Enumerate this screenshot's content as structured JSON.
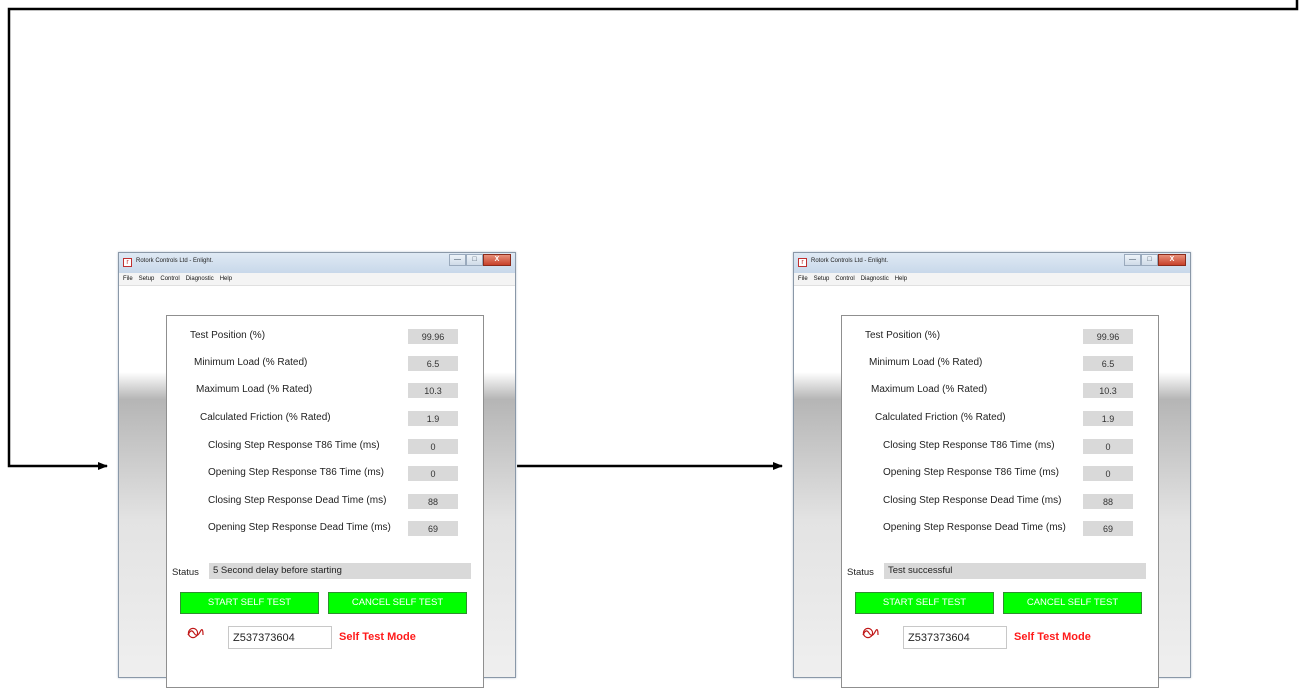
{
  "flow": {
    "line_color": "#000000",
    "arrow_style": "filled-triangle"
  },
  "windows": [
    {
      "title": "Rotork Controls Ltd - Enlight.",
      "controls": {
        "minimize": "—",
        "maximize": "□",
        "close": "X"
      },
      "menu": [
        "File",
        "Setup",
        "Control",
        "Diagnostic",
        "Help"
      ],
      "fields": [
        {
          "label": "Test Position (%)",
          "value": "99.96"
        },
        {
          "label": "Minimum Load (% Rated)",
          "value": "6.5"
        },
        {
          "label": "Maximum Load (% Rated)",
          "value": "10.3"
        },
        {
          "label": "Calculated Friction (% Rated)",
          "value": "1.9"
        },
        {
          "label": "Closing Step Response T86 Time (ms)",
          "value": "0"
        },
        {
          "label": "Opening Step Response T86 Time (ms)",
          "value": "0"
        },
        {
          "label": "Closing Step Response Dead Time (ms)",
          "value": "88"
        },
        {
          "label": "Opening Step Response Dead Time (ms)",
          "value": "69"
        }
      ],
      "status_label": "Status",
      "status_text": "5 Second delay before starting",
      "start_button": "START SELF TEST",
      "cancel_button": "CANCEL SELF TEST",
      "logo_icon": "rotork-wave-icon",
      "serial_number": "Z537373604",
      "mode_text": "Self Test Mode",
      "colors": {
        "button_bg": "#00ff00",
        "mode_text": "#ff1a1a",
        "field_bg": "#d9d9d9"
      }
    },
    {
      "title": "Rotork Controls Ltd - Enlight.",
      "controls": {
        "minimize": "—",
        "maximize": "□",
        "close": "X"
      },
      "menu": [
        "File",
        "Setup",
        "Control",
        "Diagnostic",
        "Help"
      ],
      "fields": [
        {
          "label": "Test Position (%)",
          "value": "99.96"
        },
        {
          "label": "Minimum Load (% Rated)",
          "value": "6.5"
        },
        {
          "label": "Maximum Load (% Rated)",
          "value": "10.3"
        },
        {
          "label": "Calculated Friction (% Rated)",
          "value": "1.9"
        },
        {
          "label": "Closing Step Response T86 Time (ms)",
          "value": "0"
        },
        {
          "label": "Opening Step Response T86 Time (ms)",
          "value": "0"
        },
        {
          "label": "Closing Step Response Dead Time (ms)",
          "value": "88"
        },
        {
          "label": "Opening Step Response Dead Time (ms)",
          "value": "69"
        }
      ],
      "status_label": "Status",
      "status_text": "Test successful",
      "start_button": "START SELF TEST",
      "cancel_button": "CANCEL SELF TEST",
      "logo_icon": "rotork-wave-icon",
      "serial_number": "Z537373604",
      "mode_text": "Self Test Mode",
      "colors": {
        "button_bg": "#00ff00",
        "mode_text": "#ff1a1a",
        "field_bg": "#d9d9d9"
      }
    }
  ]
}
